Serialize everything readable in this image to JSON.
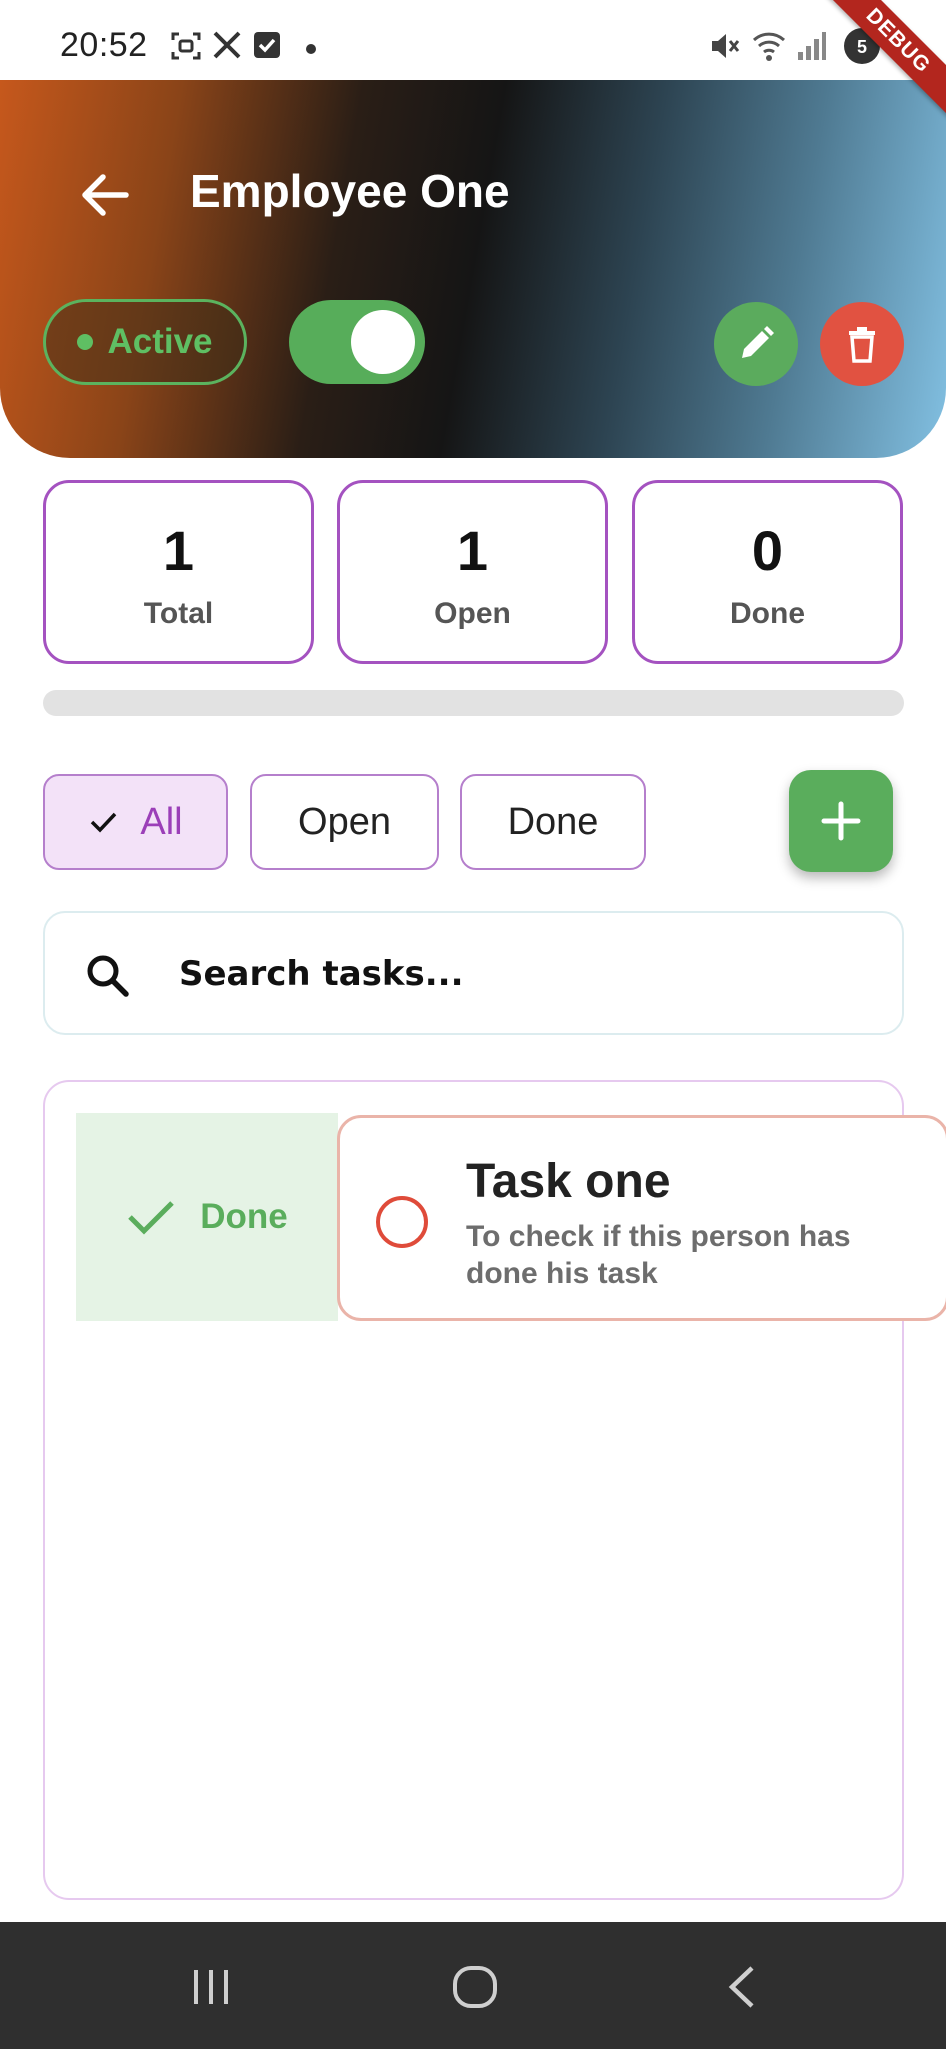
{
  "status_bar": {
    "time": "20:52",
    "icons": [
      "screenshot-icon",
      "x-icon",
      "check-square-icon",
      "notification-dot-icon",
      "mute-icon",
      "wifi-icon",
      "signal-icon",
      "battery-icon"
    ]
  },
  "debug_banner": "DEBUG",
  "header": {
    "title": "Employee One",
    "status_label": "Active",
    "status_toggle_on": true
  },
  "stats": [
    {
      "value": "1",
      "label": "Total"
    },
    {
      "value": "1",
      "label": "Open"
    },
    {
      "value": "0",
      "label": "Done"
    }
  ],
  "progress": {
    "completed_fraction": 0
  },
  "filters": {
    "all": "All",
    "open": "Open",
    "done": "Done",
    "selected": "All"
  },
  "search": {
    "placeholder": "Search tasks..."
  },
  "tasks": [
    {
      "title": "Task one",
      "description": "To check if this person has done his task",
      "swipe_action_label": "Done",
      "completed": false
    }
  ],
  "colors": {
    "accent_purple": "#a452c0",
    "green": "#5aad5c",
    "red": "#e15241",
    "nav_bar": "#2f2f2f"
  }
}
